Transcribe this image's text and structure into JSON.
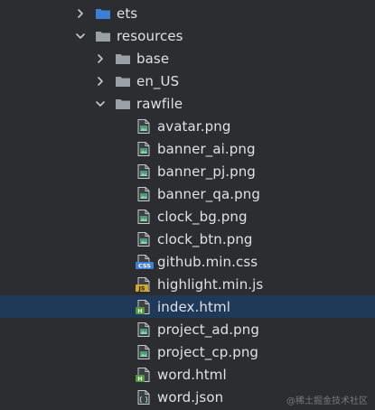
{
  "tree": {
    "folders": {
      "ets": "ets",
      "resources": "resources",
      "base": "base",
      "en_us": "en_US",
      "rawfile": "rawfile"
    },
    "files": {
      "avatar": "avatar.png",
      "banner_ai": "banner_ai.png",
      "banner_pj": "banner_pj.png",
      "banner_qa": "banner_qa.png",
      "clock_bg": "clock_bg.png",
      "clock_btn": "clock_btn.png",
      "github_css": "github.min.css",
      "highlight_js": "highlight.min.js",
      "index_html": "index.html",
      "project_ad": "project_ad.png",
      "project_cp": "project_cp.png",
      "word_html": "word.html",
      "word_json": "word.json"
    },
    "icon_badges": {
      "css": "CSS",
      "js": "JS",
      "html": "H"
    },
    "selected": "index.html"
  },
  "watermark": "@稀土掘金技术社区",
  "colors": {
    "background": "#2b2d30",
    "selection": "#1f3a59",
    "folder_blue": "#3d7fd4",
    "folder_gray": "#9aa0a6",
    "text": "#dfe1e5"
  }
}
